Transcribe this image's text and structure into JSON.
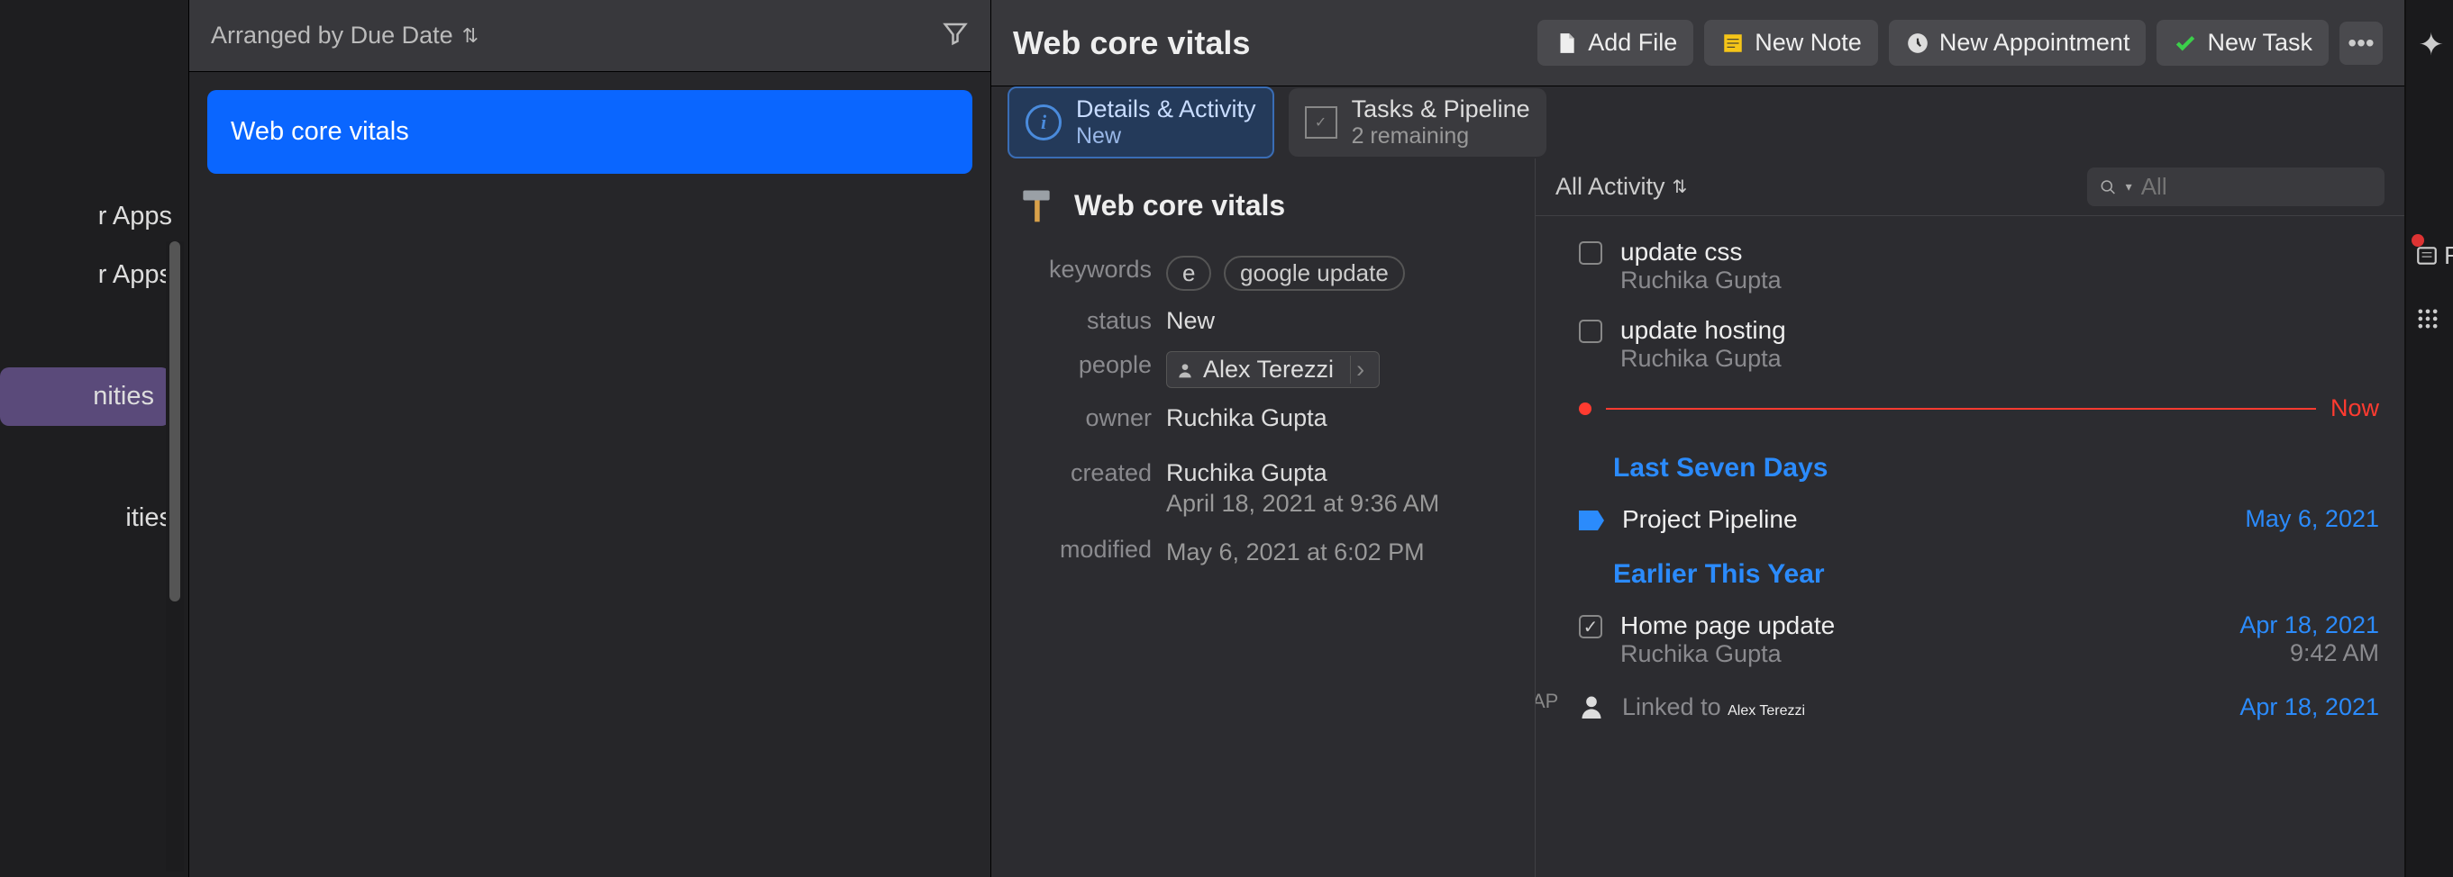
{
  "farLeft": {
    "items": [
      "r Apps",
      "r Apps",
      "nities",
      "ities"
    ]
  },
  "list": {
    "sortLabel": "Arranged by Due Date",
    "rows": [
      "Web core vitals"
    ]
  },
  "detail": {
    "title": "Web core vitals",
    "buttons": {
      "addFile": "Add File",
      "newNote": "New Note",
      "newAppointment": "New Appointment",
      "newTask": "New Task"
    },
    "tabs": {
      "details": {
        "title": "Details & Activity",
        "sub": "New"
      },
      "tasks": {
        "title": "Tasks & Pipeline",
        "sub": "2 remaining"
      }
    },
    "projectTitle": "Web core vitals",
    "fields": {
      "keywordsLabel": "keywords",
      "keywords": [
        "e",
        "google update"
      ],
      "statusLabel": "status",
      "status": "New",
      "peopleLabel": "people",
      "person": "Alex Terezzi",
      "ownerLabel": "owner",
      "owner": "Ruchika Gupta",
      "createdLabel": "created",
      "createdBy": "Ruchika Gupta",
      "createdAt": "April 18, 2021 at 9:36 AM",
      "modifiedLabel": "modified",
      "modifiedAt": "May 6, 2021 at 6:02 PM"
    }
  },
  "activity": {
    "filterLabel": "All Activity",
    "searchPlaceholder": "All",
    "pending": [
      {
        "title": "update css",
        "sub": "Ruchika Gupta"
      },
      {
        "title": "update hosting",
        "sub": "Ruchika Gupta"
      }
    ],
    "nowLabel": "Now",
    "apLabel": "AP",
    "sections": {
      "lastSeven": {
        "title": "Last Seven Days",
        "items": [
          {
            "type": "pipeline",
            "title": "Project Pipeline",
            "date": "May 6, 2021"
          }
        ]
      },
      "earlier": {
        "title": "Earlier This Year",
        "items": [
          {
            "type": "done",
            "title": "Home page update",
            "sub": "Ruchika Gupta",
            "date": "Apr 18, 2021",
            "time": "9:42 AM"
          },
          {
            "type": "link",
            "prefix": "Linked to ",
            "name": "Alex Terezzi",
            "date": "Apr 18, 2021"
          }
        ]
      }
    }
  },
  "rightStrip": {
    "r": "R"
  }
}
